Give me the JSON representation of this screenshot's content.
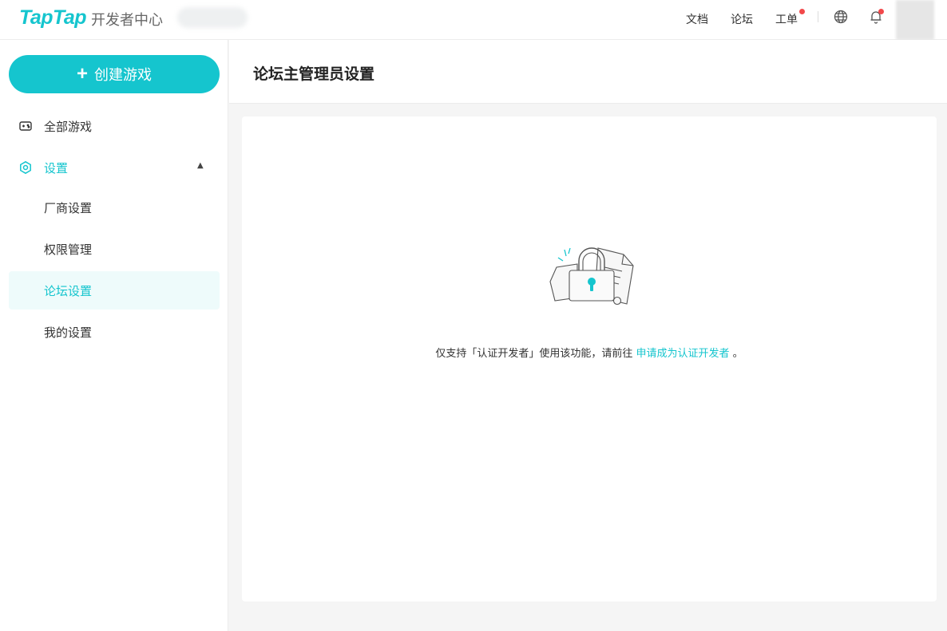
{
  "header": {
    "logo": "TapTap",
    "subtitle": "开发者中心",
    "nav": {
      "docs": "文档",
      "forum": "论坛",
      "ticket": "工单"
    },
    "icons": [
      "globe-icon",
      "bell-icon"
    ],
    "accent_color": "#15c5ce",
    "badge_color": "#f2484a"
  },
  "sidebar": {
    "create_button": "创建游戏",
    "items": [
      {
        "label": "全部游戏",
        "icon": "gamepad-icon"
      },
      {
        "label": "设置",
        "icon": "gear-icon",
        "expanded": true
      }
    ],
    "sub_items": [
      {
        "label": "厂商设置"
      },
      {
        "label": "权限管理"
      },
      {
        "label": "论坛设置",
        "active": true
      },
      {
        "label": "我的设置"
      }
    ]
  },
  "main": {
    "title": "论坛主管理员设置",
    "notice_text": "仅支持「认证开发者」使用该功能，请前往",
    "notice_link": "申请成为认证开发者",
    "notice_end": "。"
  }
}
